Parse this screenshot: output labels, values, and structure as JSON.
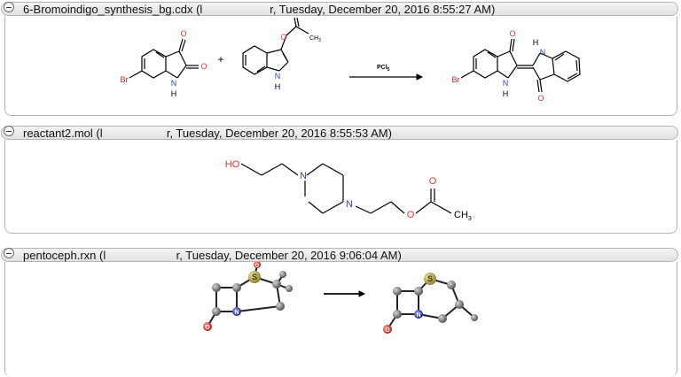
{
  "documents": [
    {
      "title": "6-Bromoindigo_synthesis_bg.cdx (l                     r, Tuesday, December 20, 2016 8:55:27 AM)",
      "reagent_label": "PCl",
      "reagent_sub": "5",
      "plus": "+",
      "atoms": {
        "br": "Br",
        "o": "O",
        "n": "N",
        "h": "H",
        "ch3": "CH",
        "sub3": "3"
      }
    },
    {
      "title": "reactant2.mol (l                    r, Tuesday, December 20, 2016 8:55:53 AM)",
      "atoms": {
        "ho": "HO",
        "n": "N",
        "o": "O",
        "ch3": "CH",
        "sub3": "3"
      }
    },
    {
      "title": "pentoceph.rxn (l                      r, Tuesday, December 20, 2016 9:06:04 AM)",
      "atoms": {
        "s": "S",
        "o": "O",
        "n": "N"
      }
    }
  ],
  "colors": {
    "oxygen": "#e8322b",
    "nitrogen": "#3140b8",
    "bromine": "#a0312a",
    "sulfur": "#c8bb4a",
    "carbon_ball": "#6e6e6e"
  }
}
